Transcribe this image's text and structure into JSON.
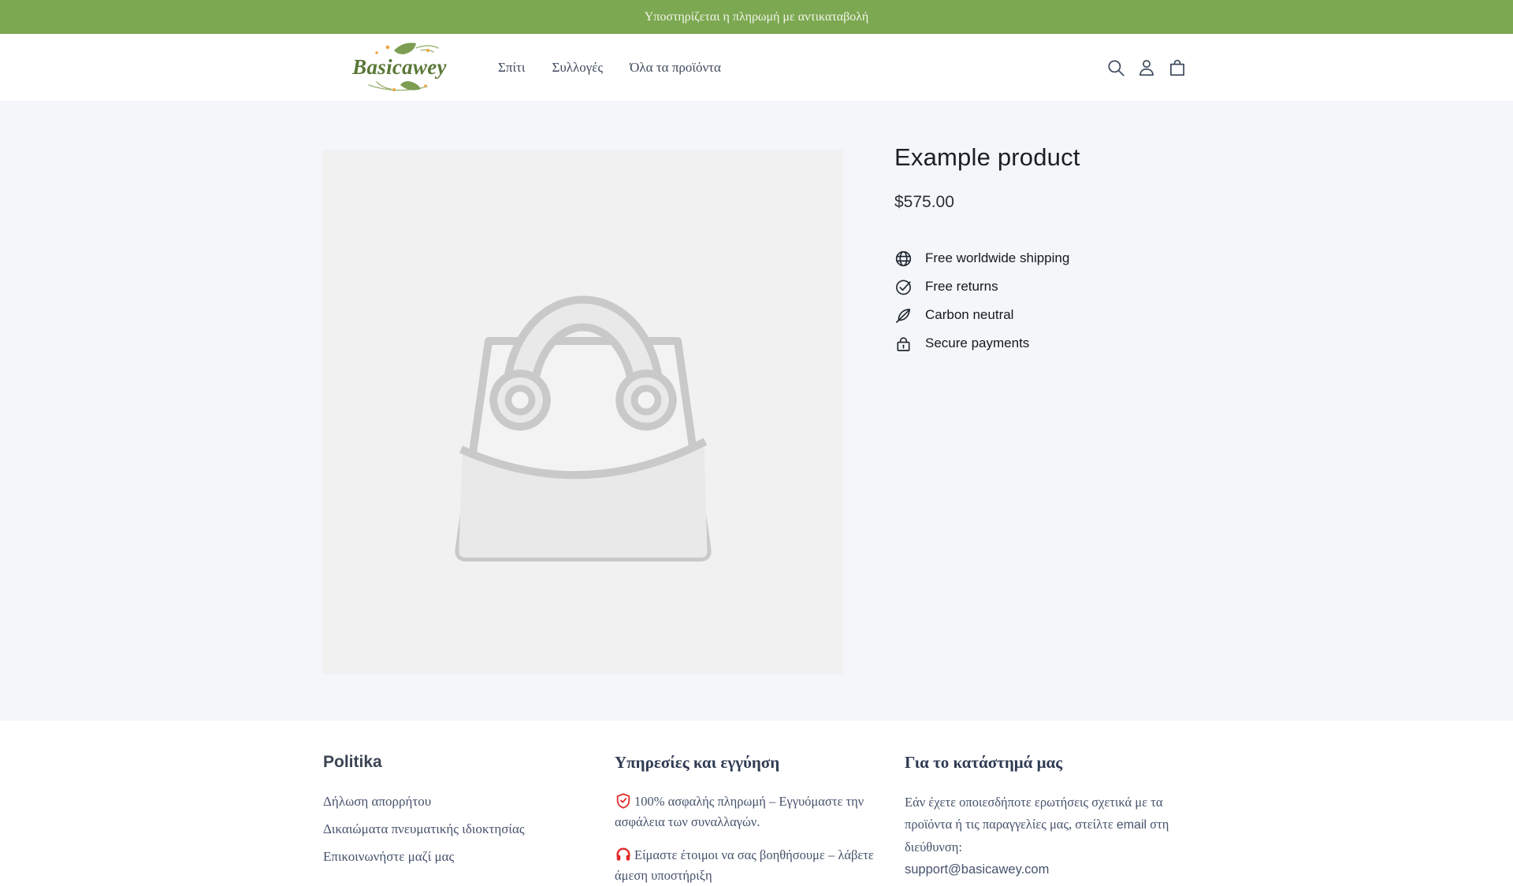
{
  "announcement": {
    "text": "Υποστηρίζεται η πληρωμή με αντικαταβολή"
  },
  "header": {
    "logo_text": "Basicawey",
    "nav": [
      {
        "label": "Σπίτι"
      },
      {
        "label": "Συλλογές"
      },
      {
        "label": "Όλα τα προϊόντα"
      }
    ],
    "icons": [
      "search-icon",
      "account-icon",
      "cart-icon"
    ]
  },
  "product": {
    "title": "Example product",
    "price": "$575.00",
    "features": [
      {
        "icon": "globe-icon",
        "label": "Free worldwide shipping"
      },
      {
        "icon": "check-circle-icon",
        "label": "Free returns"
      },
      {
        "icon": "leaf-icon",
        "label": "Carbon neutral"
      },
      {
        "icon": "lock-icon",
        "label": "Secure payments"
      }
    ]
  },
  "footer": {
    "policy": {
      "title": "Politika",
      "links": [
        "Δήλωση απορρήτου",
        "Δικαιώματα πνευματικής ιδιοκτησίας",
        "Επικοινωνήστε μαζί μας"
      ]
    },
    "services": {
      "title": "Υπηρεσίες και εγγύηση",
      "items": [
        {
          "icon": "shield-check-icon",
          "text": "100% ασφαλής πληρωμή – Εγγυόμαστε την ασφάλεια των συναλλαγών."
        },
        {
          "icon": "headset-icon",
          "text": "Είμαστε έτοιμοι να σας βοηθήσουμε – λάβετε άμεση υποστήριξη"
        }
      ]
    },
    "about": {
      "title": "Για το κατάστημά μας",
      "text_1": "Εάν έχετε οποιεσδήποτε ερωτήσεις σχετικά με τα προϊόντα ή τις παραγγελίες μας, στείλτε ",
      "email_word": "email",
      "text_2": " στη διεύθυνση:",
      "email": "support@basicawey.com"
    }
  },
  "colors": {
    "accent_green": "#7CA851",
    "logo_green": "#5a7838",
    "leaf_green": "#7d9d52",
    "flower_orange": "#eba53f",
    "main_background": "#f4f6f9",
    "media_background": "#f1f1f2",
    "placeholder_gray": "#c9c9ca",
    "nav_slate": "#3e4a5e",
    "footer_slate": "#46526c",
    "alert_red": "#e32b2b"
  }
}
